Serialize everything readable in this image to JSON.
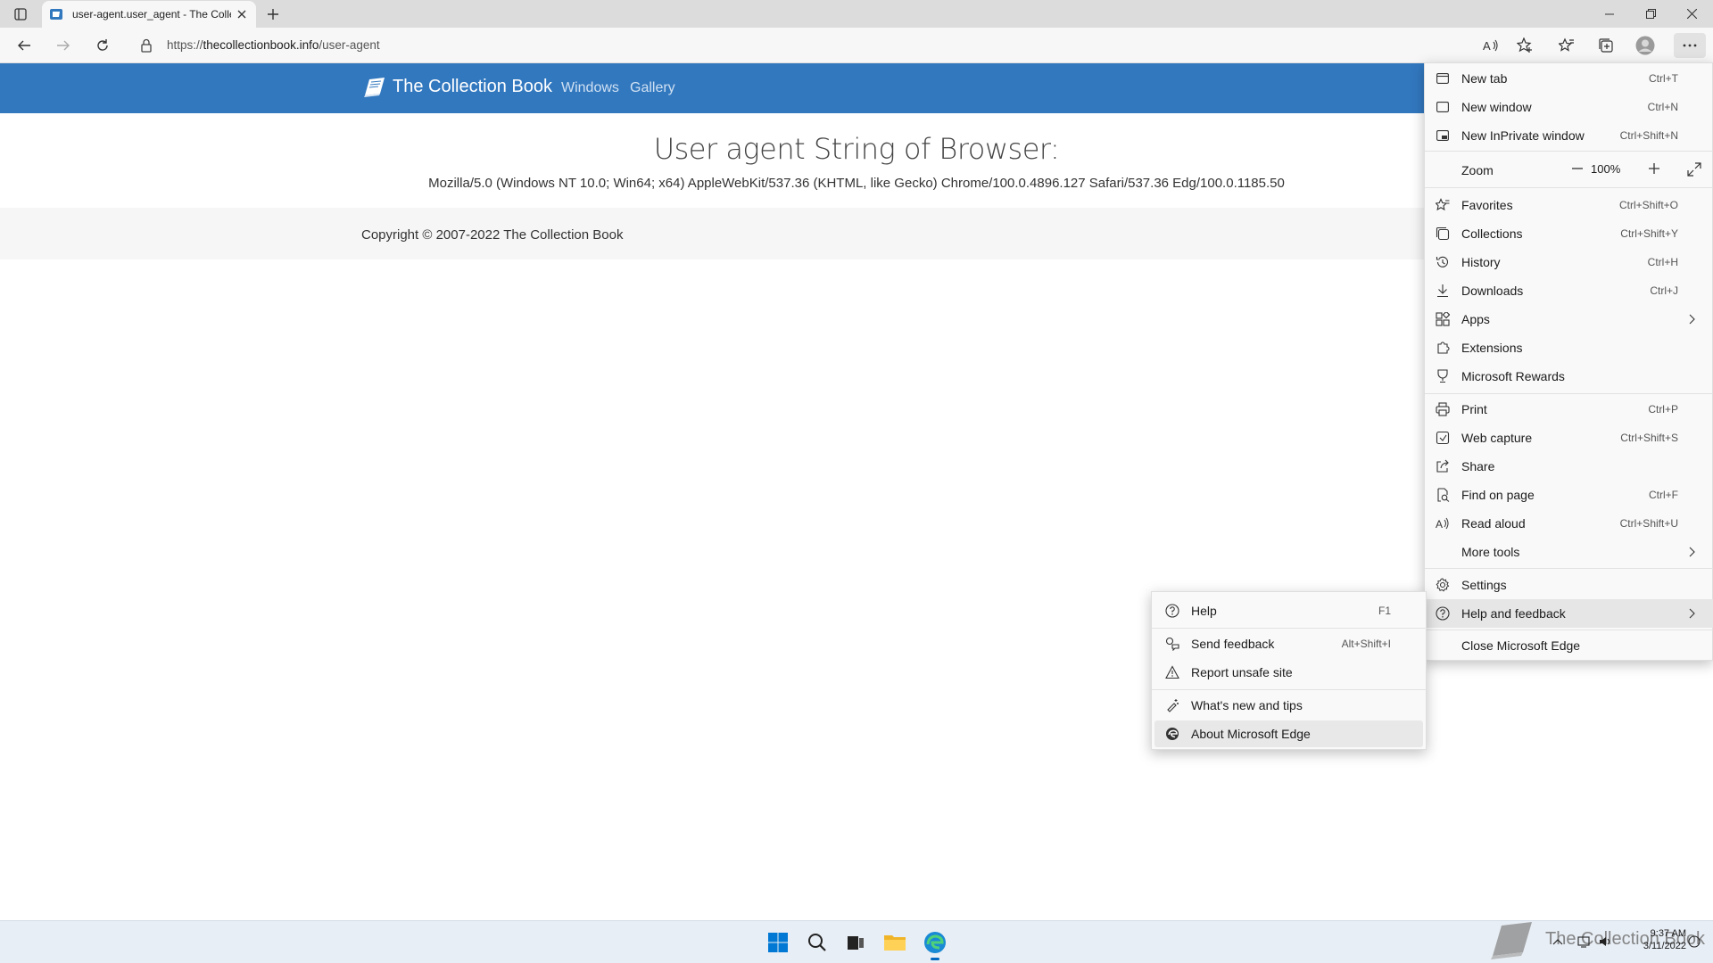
{
  "browser": {
    "tab": {
      "title": "user-agent.user_agent - The Collection Book",
      "favicon": "collection-book-icon"
    },
    "address_bar": {
      "scheme": "https://",
      "host": "thecollectionbook.info",
      "path": "/user-agent"
    },
    "toolbar_icons": [
      "back-icon",
      "forward-icon",
      "refresh-icon",
      "read-aloud-icon",
      "add-favorite-icon",
      "favorites-icon",
      "collections-icon",
      "profile-icon",
      "more-icon"
    ]
  },
  "site": {
    "brand": "The Collection Book",
    "nav": [
      "Windows",
      "Gallery"
    ],
    "heading": "User agent String of Browser:",
    "user_agent": "Mozilla/5.0 (Windows NT 10.0; Win64; x64) AppleWebKit/537.36 (KHTML, like Gecko) Chrome/100.0.4896.127 Safari/537.36 Edg/100.0.1185.50",
    "copyright": "Copyright © 2007-2022 The Collection Book",
    "header_color": "#3278bf"
  },
  "edge_menu": {
    "items": [
      {
        "label": "New tab",
        "shortcut": "Ctrl+T",
        "icon": "new-tab-icon"
      },
      {
        "label": "New window",
        "shortcut": "Ctrl+N",
        "icon": "new-window-icon"
      },
      {
        "label": "New InPrivate window",
        "shortcut": "Ctrl+Shift+N",
        "icon": "inprivate-icon"
      },
      {
        "label": "Favorites",
        "shortcut": "Ctrl+Shift+O",
        "icon": "favorites-icon"
      },
      {
        "label": "Collections",
        "shortcut": "Ctrl+Shift+Y",
        "icon": "collections-icon"
      },
      {
        "label": "History",
        "shortcut": "Ctrl+H",
        "icon": "history-icon"
      },
      {
        "label": "Downloads",
        "shortcut": "Ctrl+J",
        "icon": "downloads-icon"
      },
      {
        "label": "Apps",
        "shortcut": "",
        "icon": "apps-icon"
      },
      {
        "label": "Extensions",
        "shortcut": "",
        "icon": "extensions-icon"
      },
      {
        "label": "Microsoft Rewards",
        "shortcut": "",
        "icon": "rewards-icon"
      },
      {
        "label": "Print",
        "shortcut": "Ctrl+P",
        "icon": "print-icon"
      },
      {
        "label": "Web capture",
        "shortcut": "Ctrl+Shift+S",
        "icon": "web-capture-icon"
      },
      {
        "label": "Share",
        "shortcut": "",
        "icon": "share-icon"
      },
      {
        "label": "Find on page",
        "shortcut": "Ctrl+F",
        "icon": "find-icon"
      },
      {
        "label": "Read aloud",
        "shortcut": "Ctrl+Shift+U",
        "icon": "read-aloud-icon"
      },
      {
        "label": "More tools",
        "shortcut": "",
        "icon": ""
      },
      {
        "label": "Settings",
        "shortcut": "",
        "icon": "settings-icon"
      },
      {
        "label": "Help and feedback",
        "shortcut": "",
        "icon": "help-icon"
      },
      {
        "label": "Close Microsoft Edge",
        "shortcut": "",
        "icon": ""
      }
    ],
    "zoom": {
      "label": "Zoom",
      "value": "100%"
    }
  },
  "help_menu": {
    "items": [
      {
        "label": "Help",
        "shortcut": "F1",
        "icon": "help-icon"
      },
      {
        "label": "Send feedback",
        "shortcut": "Alt+Shift+I",
        "icon": "feedback-icon"
      },
      {
        "label": "Report unsafe site",
        "shortcut": "",
        "icon": "warning-icon"
      },
      {
        "label": "What's new and tips",
        "shortcut": "",
        "icon": "tips-icon"
      },
      {
        "label": "About Microsoft Edge",
        "shortcut": "",
        "icon": "edge-icon"
      }
    ]
  },
  "taskbar": {
    "icons": [
      "start-icon",
      "search-icon",
      "task-view-icon",
      "file-explorer-icon",
      "edge-icon"
    ],
    "clock": {
      "time": "9:37 AM",
      "date": "3/11/2022"
    },
    "watermark_text": "The Collection Book"
  }
}
